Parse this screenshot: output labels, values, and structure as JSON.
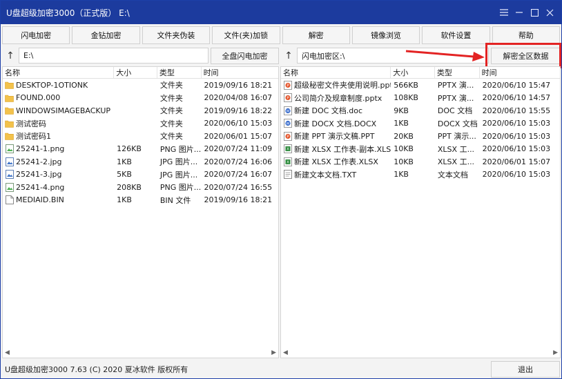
{
  "window": {
    "title": "U盘超级加密3000（正式版）  E:\\",
    "controls": [
      "menu-icon",
      "minimize-icon",
      "maximize-icon",
      "close-icon"
    ]
  },
  "toolbar": {
    "buttons": [
      "闪电加密",
      "金钻加密",
      "文件夹伪装",
      "文件(夹)加锁",
      "解密",
      "镜像浏览",
      "软件设置",
      "帮助"
    ]
  },
  "left_path": {
    "value": "E:\\",
    "button": "全盘闪电加密"
  },
  "right_path": {
    "value": "闪电加密区:\\",
    "button": "解密全区数据"
  },
  "columns": {
    "name": "名称",
    "size": "大小",
    "type": "类型",
    "time": "时间"
  },
  "left_files": [
    {
      "name": "DESKTOP-1OTIONK",
      "size": "",
      "type": "文件夹",
      "time": "2019/09/16 18:21",
      "icon": "folder-icon"
    },
    {
      "name": "FOUND.000",
      "size": "",
      "type": "文件夹",
      "time": "2020/04/08 16:07",
      "icon": "folder-icon"
    },
    {
      "name": "WINDOWSIMAGEBACKUP",
      "size": "",
      "type": "文件夹",
      "time": "2019/09/16 18:22",
      "icon": "folder-icon"
    },
    {
      "name": "测试密码",
      "size": "",
      "type": "文件夹",
      "time": "2020/06/10 15:03",
      "icon": "folder-icon"
    },
    {
      "name": "测试密码1",
      "size": "",
      "type": "文件夹",
      "time": "2020/06/01 15:07",
      "icon": "folder-icon"
    },
    {
      "name": "25241-1.png",
      "size": "126KB",
      "type": "PNG 图片...",
      "time": "2020/07/24 11:09",
      "icon": "png-icon"
    },
    {
      "name": "25241-2.jpg",
      "size": "1KB",
      "type": "JPG 图片...",
      "time": "2020/07/24 16:06",
      "icon": "jpg-icon"
    },
    {
      "name": "25241-3.jpg",
      "size": "5KB",
      "type": "JPG 图片...",
      "time": "2020/07/24 16:07",
      "icon": "jpg-icon"
    },
    {
      "name": "25241-4.png",
      "size": "208KB",
      "type": "PNG 图片...",
      "time": "2020/07/24 16:55",
      "icon": "png-icon"
    },
    {
      "name": "MEDIAID.BIN",
      "size": "1KB",
      "type": "BIN 文件",
      "time": "2019/09/16 18:21",
      "icon": "file-icon"
    }
  ],
  "right_files": [
    {
      "name": "超级秘密文件夹使用说明.pptx",
      "size": "566KB",
      "type": "PPTX 演...",
      "time": "2020/06/10 15:47",
      "icon": "pptx-icon"
    },
    {
      "name": "公司简介及规章制度.pptx",
      "size": "108KB",
      "type": "PPTX 演...",
      "time": "2020/06/10 14:57",
      "icon": "pptx-icon"
    },
    {
      "name": "新建 DOC 文档.doc",
      "size": "9KB",
      "type": "DOC 文档",
      "time": "2020/06/10 15:55",
      "icon": "doc-icon"
    },
    {
      "name": "新建 DOCX 文档.DOCX",
      "size": "1KB",
      "type": "DOCX 文档",
      "time": "2020/06/10 15:03",
      "icon": "doc-icon"
    },
    {
      "name": "新建 PPT 演示文稿.PPT",
      "size": "20KB",
      "type": "PPT 演示...",
      "time": "2020/06/10 15:03",
      "icon": "pptx-icon"
    },
    {
      "name": "新建 XLSX 工作表-副本.XLSX",
      "size": "10KB",
      "type": "XLSX 工...",
      "time": "2020/06/10 15:03",
      "icon": "xlsx-icon"
    },
    {
      "name": "新建 XLSX 工作表.XLSX",
      "size": "10KB",
      "type": "XLSX 工...",
      "time": "2020/06/01 15:07",
      "icon": "xlsx-icon"
    },
    {
      "name": "新建文本文档.TXT",
      "size": "1KB",
      "type": "文本文档",
      "time": "2020/06/10 15:03",
      "icon": "txt-icon"
    }
  ],
  "status": {
    "text": "U盘超级加密3000 7.63 (C) 2020 夏冰软件 版权所有",
    "exit": "退出"
  },
  "colors": {
    "titlebar": "#1c3b9e",
    "highlight": "#e32323",
    "folder": "#f3c24b"
  }
}
